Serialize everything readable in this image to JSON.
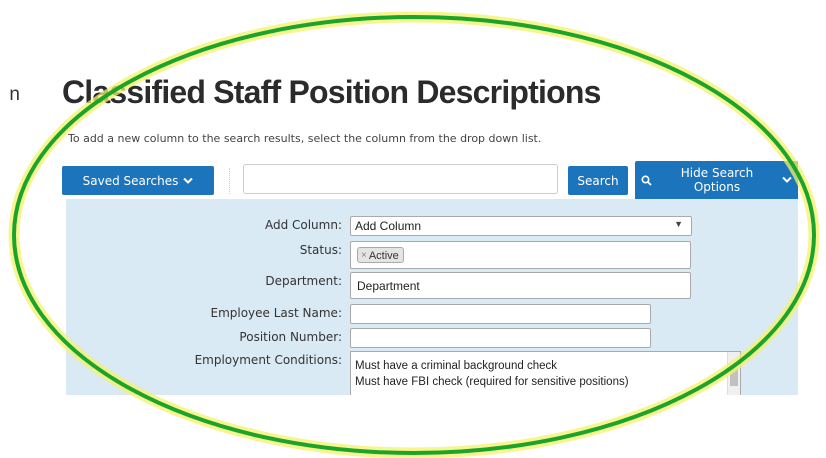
{
  "left_fragment": "n",
  "page_title": "Classified Staff Position Descriptions",
  "instructions": "To add a new column to the search results, select the column from the drop down list.",
  "toolbar": {
    "saved_searches_label": "Saved Searches",
    "search_input_value": "",
    "search_label": "Search",
    "hide_options_label": "Hide Search Options"
  },
  "search_panel": {
    "add_column": {
      "label": "Add Column:",
      "value": "Add Column"
    },
    "status": {
      "label": "Status:",
      "tags": [
        "Active"
      ]
    },
    "department": {
      "label": "Department:",
      "placeholder": "Department"
    },
    "employee_last_name": {
      "label": "Employee Last Name:",
      "value": ""
    },
    "position_number": {
      "label": "Position Number:",
      "value": ""
    },
    "employment_conditions": {
      "label": "Employment Conditions:",
      "options": [
        "Must have a criminal background check",
        "Must have FBI check (required for sensitive positions)"
      ]
    }
  },
  "colors": {
    "primary_button": "#1c75bc",
    "panel_background": "#d9eaf5",
    "annotation_ellipse_stroke": "#1aa52a",
    "annotation_ellipse_glow": "#f5f06a"
  }
}
